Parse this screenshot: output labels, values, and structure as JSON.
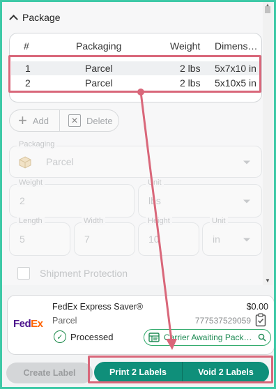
{
  "package_section": {
    "title": "Package",
    "table": {
      "headers": [
        "#",
        "Packaging",
        "Weight",
        "Dimens…"
      ],
      "rows": [
        {
          "num": "1",
          "packaging": "Parcel",
          "weight": "2 lbs",
          "dimensions": "5x7x10 in"
        },
        {
          "num": "2",
          "packaging": "Parcel",
          "weight": "2 lbs",
          "dimensions": "5x10x5 in"
        }
      ]
    },
    "actions": {
      "add": "Add",
      "delete": "Delete"
    },
    "form": {
      "packaging_label": "Packaging",
      "packaging_value": "Parcel",
      "weight_label": "Weight",
      "weight_value": "2",
      "unit_label": "Unit",
      "unit_value": "lbs",
      "length_label": "Length",
      "length_value": "5",
      "width_label": "Width",
      "width_value": "7",
      "height_label": "Height",
      "height_value": "10",
      "dim_unit_label": "Unit",
      "dim_unit_value": "in"
    },
    "shipment_protection_label": "Shipment Protection"
  },
  "carrier_card": {
    "logo_part1": "Fed",
    "logo_part2": "Ex",
    "service": "FedEx Express Saver®",
    "price": "$0.00",
    "package_type": "Parcel",
    "tracking_number": "777537529059",
    "status": "Processed",
    "manifest_status": "Carrier Awaiting Pack…"
  },
  "footer": {
    "create_label": "Create Label",
    "print_labels": "Print 2 Labels",
    "void_labels": "Void 2 Labels"
  },
  "colors": {
    "accent": "#0f8f7a",
    "annotation": "#d9677a",
    "frame": "#3ec9a7",
    "success": "#1b8a4a"
  }
}
